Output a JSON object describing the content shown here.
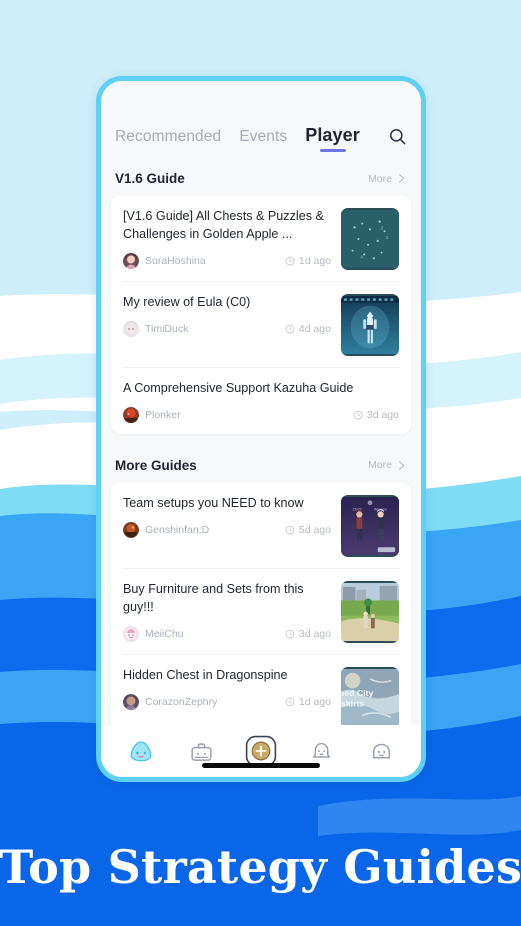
{
  "banner": {
    "text": "Top Strategy Guides"
  },
  "colors": {
    "page_bg_top": "#cdeefa",
    "wave_white": "#ffffff",
    "wave_cyan": "#7fdcf5",
    "wave_blue_light": "#3aa5f5",
    "wave_blue": "#0a6ef0",
    "wave_blue_deep": "#0b5ce8",
    "banner_blue": "#0a66e8",
    "phone_frame": "#5fd0f3",
    "screen_bg": "#f7f8fa",
    "card_bg": "#ffffff",
    "active_tab_underline": "#6f74e8",
    "title_text": "#232733",
    "muted_text": "#b6bac3"
  },
  "tabs": [
    {
      "label": "Recommended",
      "active": false
    },
    {
      "label": "Events",
      "active": false
    },
    {
      "label": "Player",
      "active": true
    }
  ],
  "search": {
    "icon": "search-icon"
  },
  "sections": [
    {
      "title": "V1.6 Guide",
      "more_label": "More",
      "posts": [
        {
          "title": "[V1.6 Guide] All Chests & Puzzles & Challenges in Golden Apple ...",
          "author": "SoraHoshina",
          "time": "1d ago",
          "has_thumb": true,
          "thumb": "puzzle-map"
        },
        {
          "title": "My review of Eula (C0)",
          "author": "TimiDuck",
          "time": "4d ago",
          "has_thumb": true,
          "thumb": "eula-character"
        },
        {
          "title": "A Comprehensive Support Kazuha Guide",
          "author": "Plonker",
          "time": "3d ago",
          "has_thumb": false,
          "thumb": ""
        }
      ]
    },
    {
      "title": "More Guides",
      "more_label": "More",
      "posts": [
        {
          "title": "Team setups you NEED to know",
          "author": "Genshinfan:D",
          "time": "5d ago",
          "has_thumb": true,
          "thumb": "team-setup"
        },
        {
          "title": "Buy Furniture and Sets from this guy!!!",
          "author": "MeiiChu",
          "time": "3d ago",
          "has_thumb": true,
          "thumb": "furniture-shop"
        },
        {
          "title": "Hidden Chest in Dragonspine",
          "author": "CorazonZephry",
          "time": "1d ago",
          "has_thumb": true,
          "thumb": "dragonspine-map"
        }
      ]
    }
  ],
  "bottom_nav": [
    {
      "name": "home",
      "icon": "slime-home-icon",
      "active": true
    },
    {
      "name": "tools",
      "icon": "toolbox-icon",
      "active": false
    },
    {
      "name": "post",
      "icon": "plus-circle-icon",
      "active": false
    },
    {
      "name": "notifications",
      "icon": "bell-icon",
      "active": false
    },
    {
      "name": "profile",
      "icon": "ghost-profile-icon",
      "active": false
    }
  ]
}
